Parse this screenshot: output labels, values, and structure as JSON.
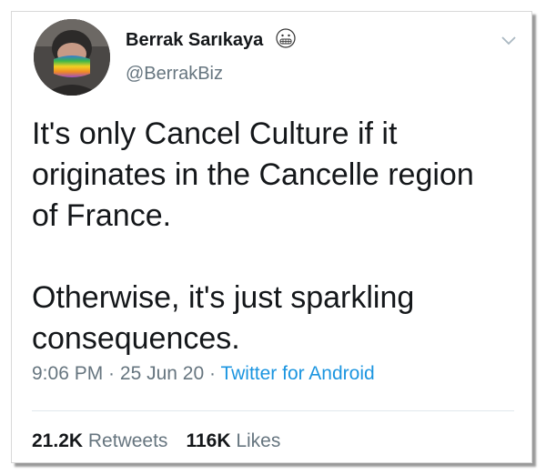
{
  "author": {
    "display_name": "Berrak Sarıkaya",
    "handle": "@BerrakBiz",
    "avatar_icon": "user-avatar-icon",
    "emoji_icon": "grimacing-face-emoji"
  },
  "tweet": {
    "text": "It's only Cancel Culture if it\noriginates in the Cancelle region\nof France.\n\nOtherwise, it's just sparkling\nconsequences.",
    "time": "9:06 PM",
    "date": "25 Jun 20",
    "separator": " · ",
    "source": "Twitter for Android"
  },
  "stats": {
    "retweets_count": "21.2K",
    "retweets_label": "Retweets",
    "likes_count": "116K",
    "likes_label": "Likes"
  },
  "colors": {
    "text": "#14171a",
    "secondary": "#66757f",
    "link": "#1b95e0",
    "divider": "#e1e8ed"
  }
}
